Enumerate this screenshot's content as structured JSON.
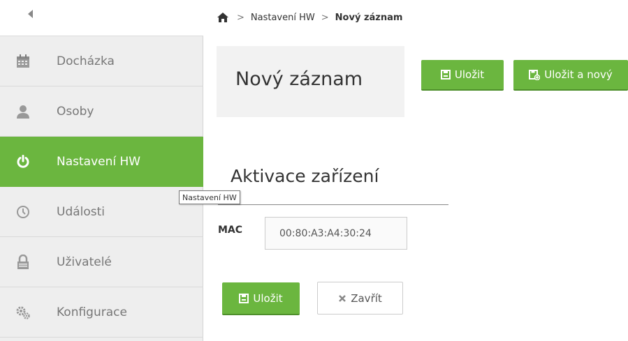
{
  "sidebar": {
    "toggle_icon": "caret-left-icon",
    "items": [
      {
        "label": "Docházka",
        "icon": "calendar-icon",
        "active": false
      },
      {
        "label": "Osoby",
        "icon": "user-icon",
        "active": false
      },
      {
        "label": "Nastavení HW",
        "icon": "power-icon",
        "active": true
      },
      {
        "label": "Události",
        "icon": "clock-icon",
        "active": false
      },
      {
        "label": "Uživatelé",
        "icon": "lock-icon",
        "active": false
      },
      {
        "label": "Konfigurace",
        "icon": "gears-icon",
        "active": false
      }
    ],
    "tooltip": "Nastavení HW"
  },
  "breadcrumb": {
    "home_icon": "home-icon",
    "items": [
      "Nastavení HW",
      "Nový záznam"
    ]
  },
  "header": {
    "title": "Nový záznam",
    "save_label": "Uložit",
    "save_new_label": "Uložit a nový"
  },
  "form": {
    "section_title": "Aktivace zařízení",
    "mac_label": "MAC",
    "mac_value": "00:80:A3:A4:30:24",
    "save_label": "Uložit",
    "close_label": "Zavřít"
  },
  "colors": {
    "accent": "#6bb63f",
    "sidebar_bg": "#eeeeee",
    "title_card_bg": "#f2f2f2"
  }
}
